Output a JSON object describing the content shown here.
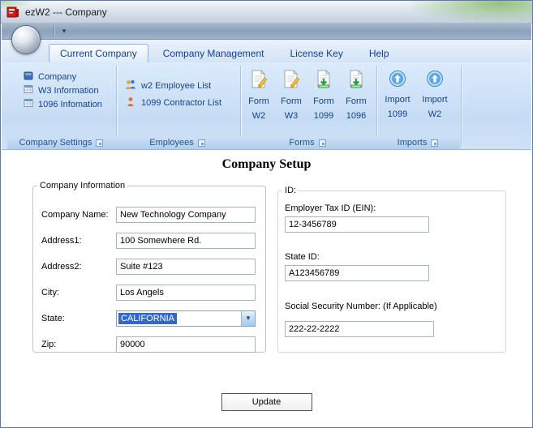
{
  "window": {
    "title": "ezW2 --- Company"
  },
  "icons": {
    "qat_dropdown": "▾",
    "combo_arrow": "▼"
  },
  "colors": {
    "accent_text": "#15428b",
    "selection_blue": "#316ac5",
    "ribbon_bg": "#cde0f5",
    "title_green_tint": "#76b254"
  },
  "tabs": {
    "items": [
      {
        "label": "Current Company"
      },
      {
        "label": "Company Management"
      },
      {
        "label": "License Key"
      },
      {
        "label": "Help"
      }
    ]
  },
  "ribbon": {
    "company_settings": {
      "name": "Company Settings",
      "items": [
        {
          "label": "Company"
        },
        {
          "label": "W3 Information"
        },
        {
          "label": "1096 Infomation"
        }
      ]
    },
    "employees": {
      "name": "Employees",
      "items": [
        {
          "label": "w2 Employee List"
        },
        {
          "label": "1099 Contractor List"
        }
      ]
    },
    "forms": {
      "name": "Forms",
      "items": [
        {
          "line1": "Form",
          "line2": "W2"
        },
        {
          "line1": "Form",
          "line2": "W3"
        },
        {
          "line1": "Form",
          "line2": "1099"
        },
        {
          "line1": "Form",
          "line2": "1096"
        }
      ]
    },
    "imports": {
      "name": "Imports",
      "items": [
        {
          "line1": "Import",
          "line2": "1099"
        },
        {
          "line1": "Import",
          "line2": "W2"
        }
      ]
    }
  },
  "main": {
    "title": "Company Setup",
    "company_info": {
      "legend": "Company Information",
      "company_name": {
        "label": "Company Name:",
        "value": "New Technology Company"
      },
      "address1": {
        "label": "Address1:",
        "value": "100 Somewhere Rd."
      },
      "address2": {
        "label": "Address2:",
        "value": "Suite #123"
      },
      "city": {
        "label": "City:",
        "value": "Los Angels"
      },
      "state": {
        "label": "State:",
        "value": "CALIFORNIA"
      },
      "zip": {
        "label": "Zip:",
        "value": "90000"
      }
    },
    "ids": {
      "legend": "ID:",
      "ein": {
        "label": "Employer Tax ID (EIN):",
        "value": "12-3456789"
      },
      "state_id": {
        "label": "State ID:",
        "value": "A123456789"
      },
      "ssn": {
        "label": "Social Security Number: (If Applicable)",
        "value": "222-22-2222"
      }
    },
    "update_button": "Update"
  }
}
